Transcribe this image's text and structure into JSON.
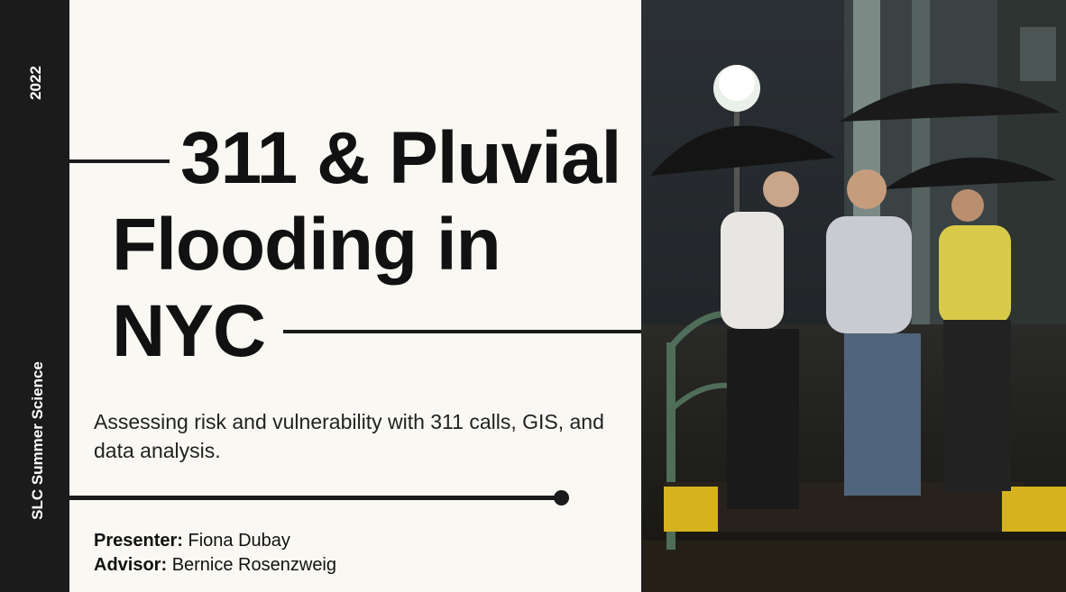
{
  "sidebar": {
    "year": "2022",
    "org": "SLC Summer Science"
  },
  "title": {
    "line1": "311 & Pluvial",
    "line2": "Flooding in",
    "line3": "NYC"
  },
  "subtitle": "Assessing risk and vulnerability with 311 calls, GIS, and data analysis.",
  "credits": {
    "presenter_label": "Presenter:",
    "presenter_name": "Fiona Dubay",
    "advisor_label": "Advisor:",
    "advisor_name": "Bernice Rosenzweig"
  },
  "colors": {
    "background": "#faf8f3",
    "sidebar": "#1b1b1b",
    "text": "#111111"
  }
}
